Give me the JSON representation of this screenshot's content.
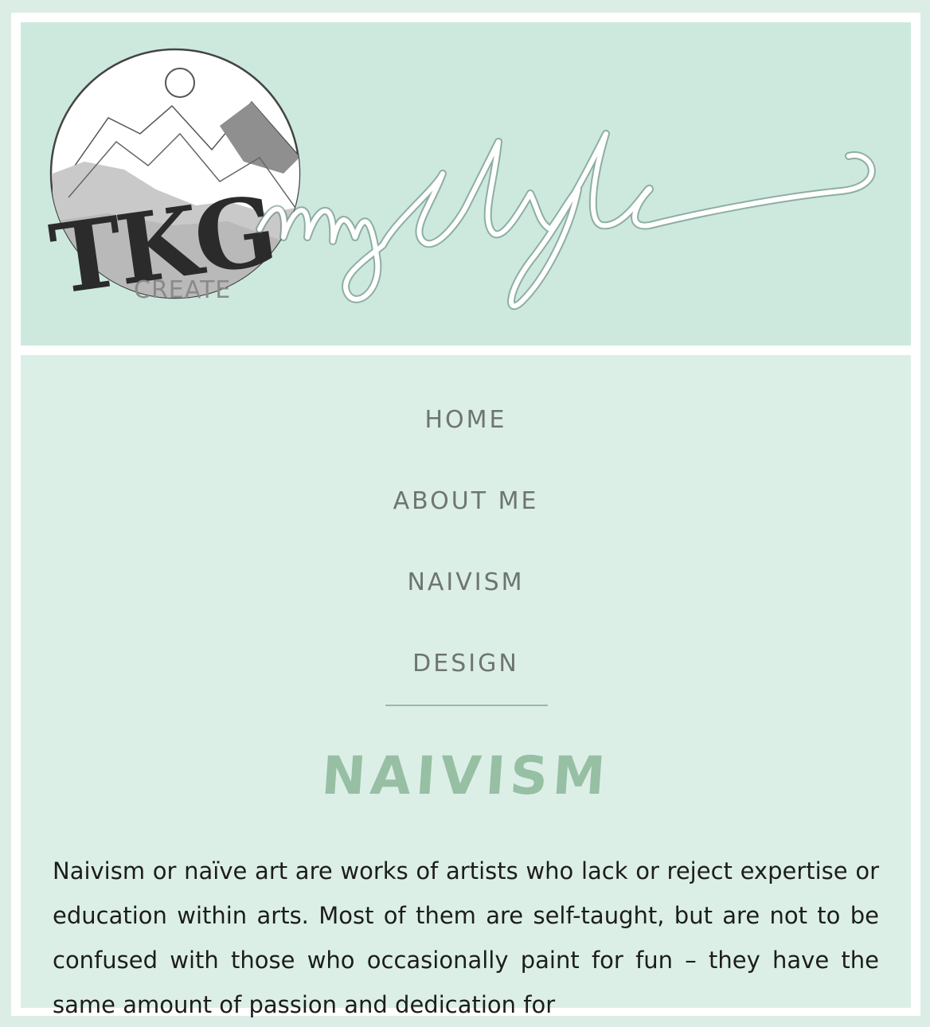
{
  "brand": {
    "logo_text": "TKG",
    "logo_subtext": "CREATE",
    "title_script": "my style"
  },
  "nav": {
    "items": [
      {
        "label": "HOME"
      },
      {
        "label": "ABOUT ME"
      },
      {
        "label": "NAIVISM"
      },
      {
        "label": "DESIGN"
      }
    ]
  },
  "section": {
    "title": "NAIVISM",
    "body": "Naivism or naïve art are works of artists who lack or reject expertise or education within arts. Most of them are self-taught, but are not to be confused with those who occasionally paint for fun – they have the same amount of passion and dedication for"
  },
  "colors": {
    "background": "#dcede6",
    "banner": "#cde9de",
    "content_bg": "#dcefe7",
    "nav_text": "#6e7571",
    "title_accent": "#96bfa4",
    "body_text": "#1d1d1d"
  }
}
